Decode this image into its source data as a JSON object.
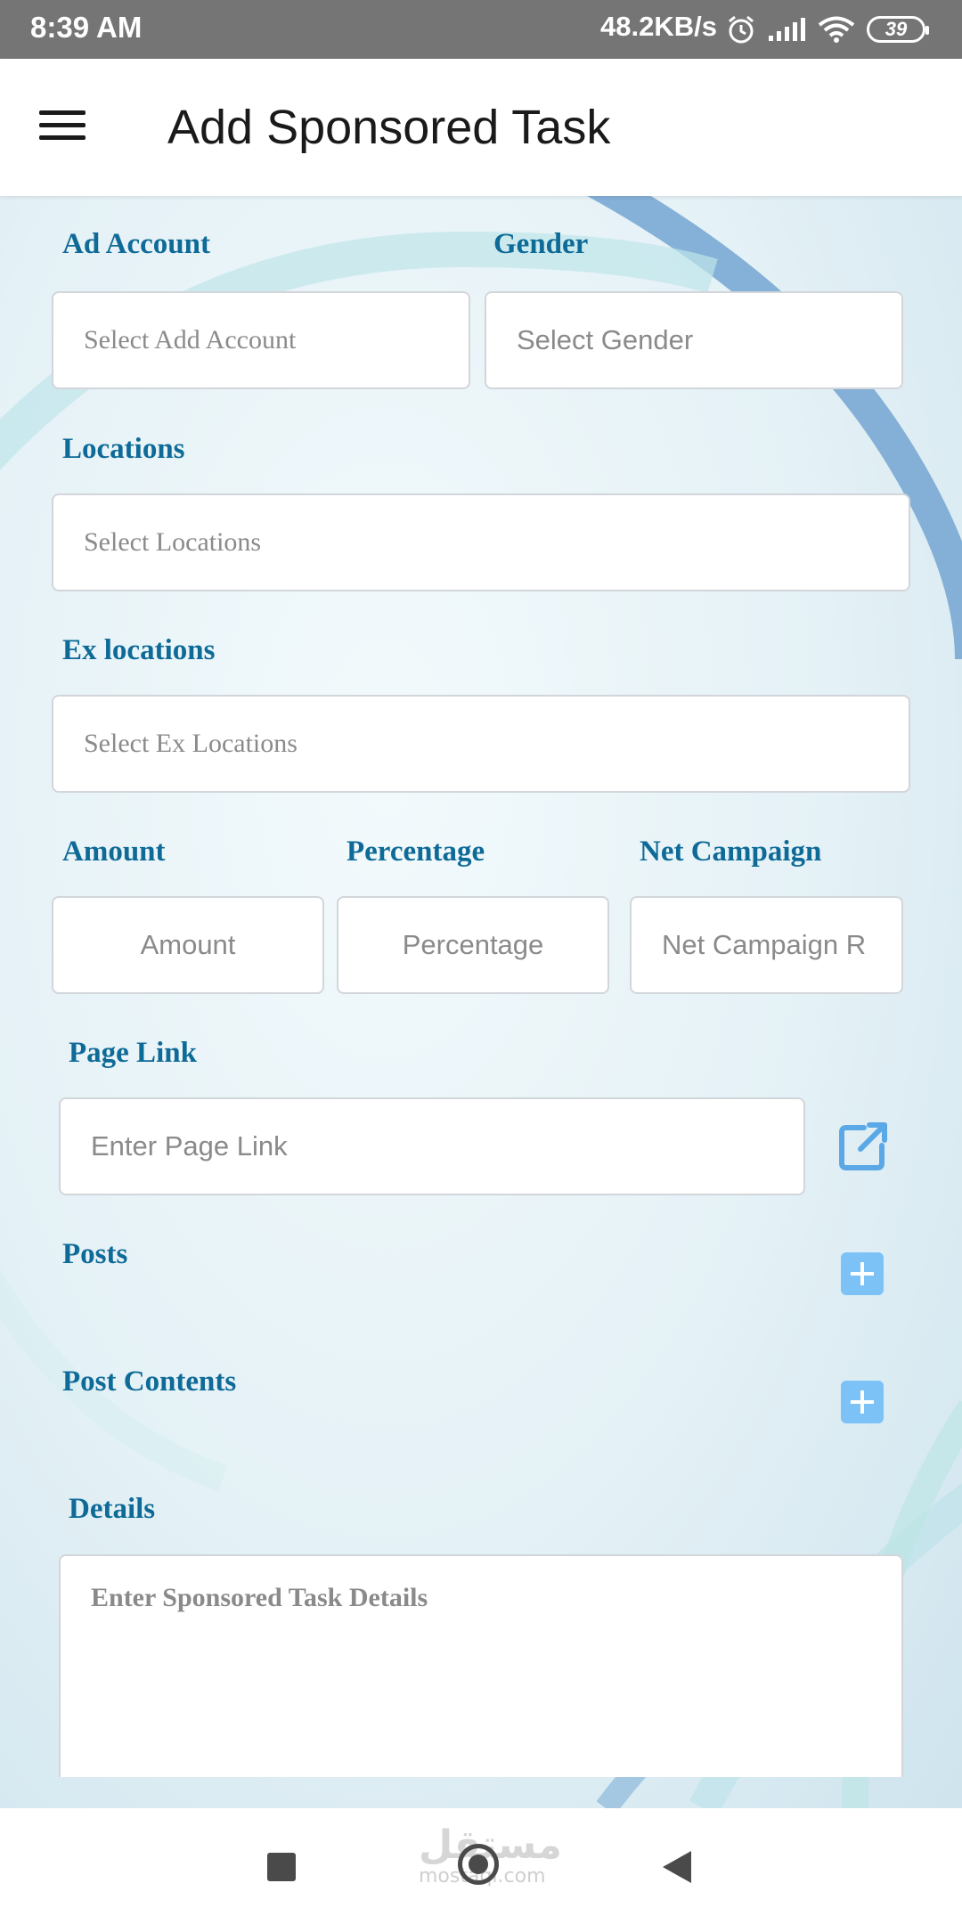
{
  "status_bar": {
    "time": "8:39 AM",
    "network_speed": "48.2KB/s",
    "battery": "39",
    "icons": [
      "alarm-icon",
      "signal-icon",
      "wifi-icon",
      "battery-icon"
    ]
  },
  "app_bar": {
    "title": "Add Sponsored Task",
    "menu_icon": "hamburger-menu-icon"
  },
  "form": {
    "ad_account": {
      "label": "Ad Account",
      "placeholder": "Select Add Account"
    },
    "gender": {
      "label": "Gender",
      "placeholder": "Select Gender"
    },
    "locations": {
      "label": "Locations",
      "placeholder": "Select Locations"
    },
    "ex_locations": {
      "label": "Ex locations",
      "placeholder": "Select Ex Locations"
    },
    "amount": {
      "label": "Amount",
      "placeholder": "Amount"
    },
    "percentage": {
      "label": "Percentage",
      "placeholder": "Percentage"
    },
    "net_campaign": {
      "label": "Net Campaign",
      "placeholder": "Net Campaign R"
    },
    "page_link": {
      "label": "Page Link",
      "placeholder": "Enter Page Link",
      "icon": "open-external-link-icon"
    },
    "posts": {
      "label": "Posts",
      "icon": "add-plus-icon"
    },
    "post_contents": {
      "label": "Post Contents",
      "icon": "add-plus-icon"
    },
    "details": {
      "label": "Details",
      "placeholder": "Enter Sponsored Task Details"
    }
  },
  "nav_bar": {
    "icons": [
      "recent-apps-icon",
      "home-icon",
      "back-icon"
    ],
    "watermark_arabic": "مستقل",
    "watermark_latin": "mostaql.com"
  },
  "colors": {
    "accent_label": "#0e6a97",
    "plus_button": "#7cc2f7",
    "status_bar": "#757575"
  }
}
